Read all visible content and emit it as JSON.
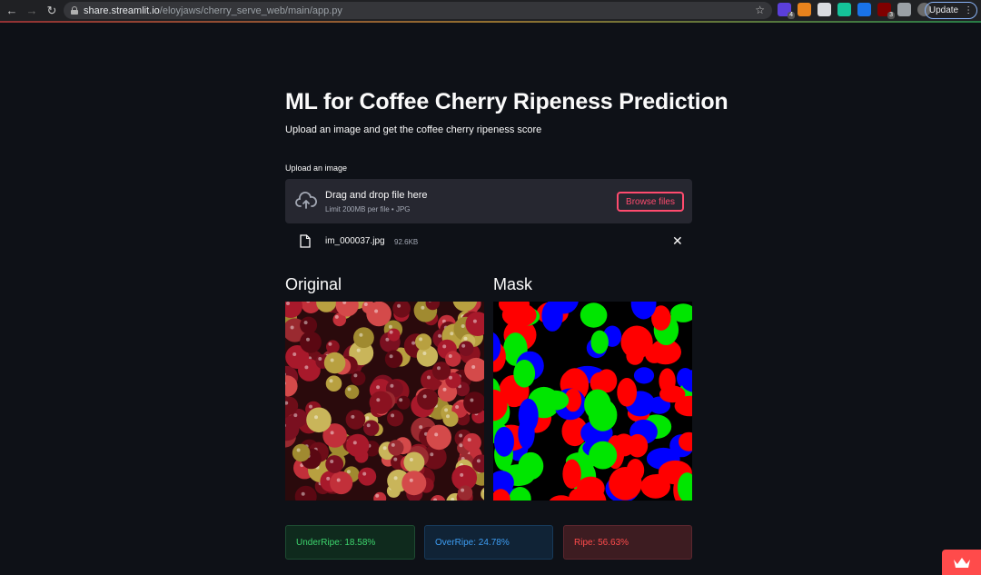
{
  "browser": {
    "url_host": "share.streamlit.io",
    "url_path": "/eloyjaws/cherry_serve_web/main/app.py",
    "update_label": "Update",
    "extensions": [
      {
        "name": "ext-1-icon",
        "color": "#5b3fd9",
        "badge": "4"
      },
      {
        "name": "metamask-icon",
        "color": "#e8831d",
        "badge": ""
      },
      {
        "name": "document-icon",
        "color": "#dadce0",
        "badge": ""
      },
      {
        "name": "grammarly-icon",
        "color": "#15c39a",
        "badge": ""
      },
      {
        "name": "tag-icon",
        "color": "#1a73e8",
        "badge": ""
      },
      {
        "name": "ublock-icon",
        "color": "#800000",
        "badge": "3"
      }
    ]
  },
  "app": {
    "title": "ML for Coffee Cherry Ripeness Prediction",
    "subtitle": "Upload an image and get the coffee cherry ripeness score",
    "upload_label": "Upload an image",
    "dropzone": {
      "title": "Drag and drop file here",
      "limit": "Limit 200MB per file • JPG",
      "browse_label": "Browse files"
    },
    "file": {
      "name": "im_000037.jpg",
      "size": "92.6KB"
    },
    "columns": {
      "original": "Original",
      "mask": "Mask"
    },
    "metrics": {
      "underripe": "UnderRipe: 18.58%",
      "overripe": "OverRipe: 24.78%",
      "ripe": "Ripe: 56.63%"
    },
    "colors": {
      "background": "#0e1117",
      "panel": "#262730",
      "accent": "#ff4b4b",
      "underripe": "#3dd56d",
      "overripe": "#3d9df3",
      "ripe": "#ff4b4b"
    }
  }
}
